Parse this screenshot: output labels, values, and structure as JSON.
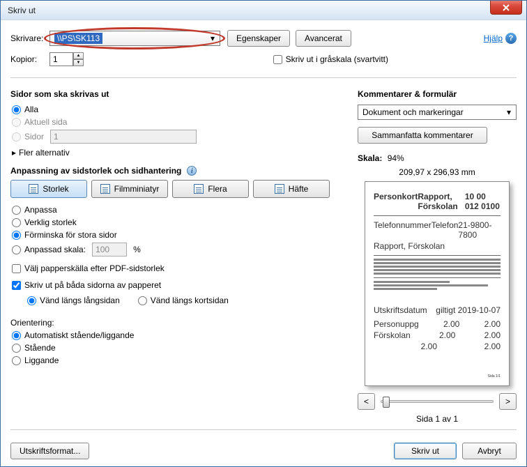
{
  "window": {
    "title": "Skriv ut"
  },
  "top": {
    "printer_label": "Skrivare:",
    "printer_value": "\\\\PS\\SK113",
    "properties": "Egenskaper",
    "advanced": "Avancerat",
    "help": "Hjälp",
    "copies_label": "Kopior:",
    "copies_value": "1",
    "grayscale": "Skriv ut i gråskala (svartvitt)"
  },
  "pages": {
    "heading": "Sidor som ska skrivas ut",
    "all": "Alla",
    "current": "Aktuell sida",
    "range_label": "Sidor",
    "range_value": "1",
    "more": "Fler alternativ"
  },
  "sizing": {
    "heading": "Anpassning av sidstorlek och sidhantering",
    "size": "Storlek",
    "thumbs": "Filmminiatyr",
    "multiple": "Flera",
    "booklet": "Häfte",
    "fit": "Anpassa",
    "actual": "Verklig storlek",
    "shrink": "Förminska för stora sidor",
    "custom_label": "Anpassad skala:",
    "custom_value": "100",
    "custom_unit": "%",
    "paper_source": "Välj papperskälla efter PDF-sidstorlek",
    "duplex": "Skriv ut på båda sidorna av papperet",
    "flip_long": "Vänd längs långsidan",
    "flip_short": "Vänd längs kortsidan",
    "orientation_label": "Orientering:",
    "orient_auto": "Automatiskt stående/liggande",
    "orient_portrait": "Stående",
    "orient_landscape": "Liggande"
  },
  "comments": {
    "heading": "Kommentarer & formulär",
    "selected": "Dokument och markeringar",
    "summarize": "Sammanfatta kommentarer"
  },
  "preview": {
    "scale_label": "Skala:",
    "scale_value": "94%",
    "dims": "209,97 x 296,93 mm",
    "page_indicator": "Sida 1 av 1",
    "prev": "<",
    "next": ">"
  },
  "footer": {
    "page_setup": "Utskriftsformat...",
    "print": "Skriv ut",
    "cancel": "Avbryt"
  }
}
